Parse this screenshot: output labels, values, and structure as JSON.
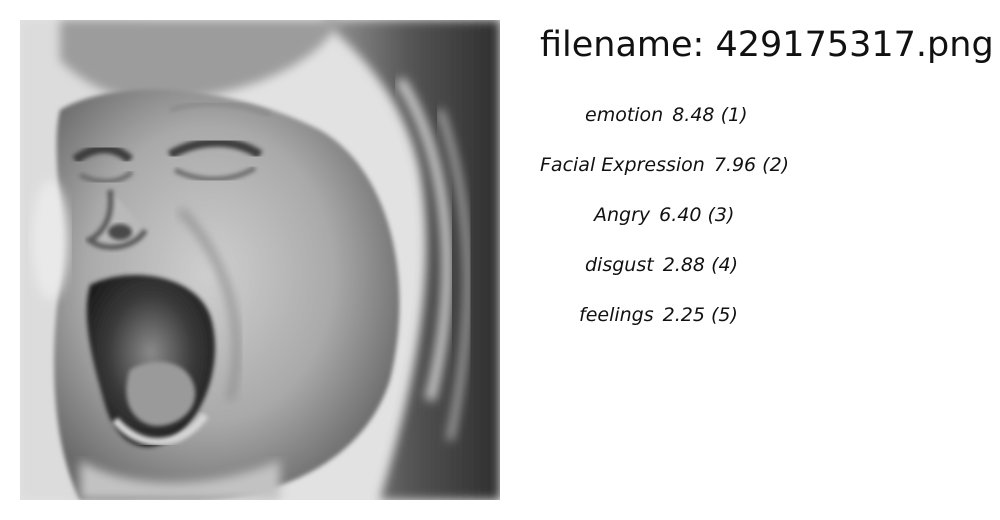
{
  "header": {
    "filename_prefix": "filename:",
    "filename": "429175317.png"
  },
  "labels": [
    {
      "name": "emotion",
      "score": "8.48",
      "rank": "(1)"
    },
    {
      "name": "Facial Expression",
      "score": "7.96",
      "rank": "(2)"
    },
    {
      "name": "Angry",
      "score": "6.40",
      "rank": "(3)"
    },
    {
      "name": "disgust",
      "score": "2.88",
      "rank": "(4)"
    },
    {
      "name": "feelings",
      "score": "2.25",
      "rank": "(5)"
    }
  ]
}
